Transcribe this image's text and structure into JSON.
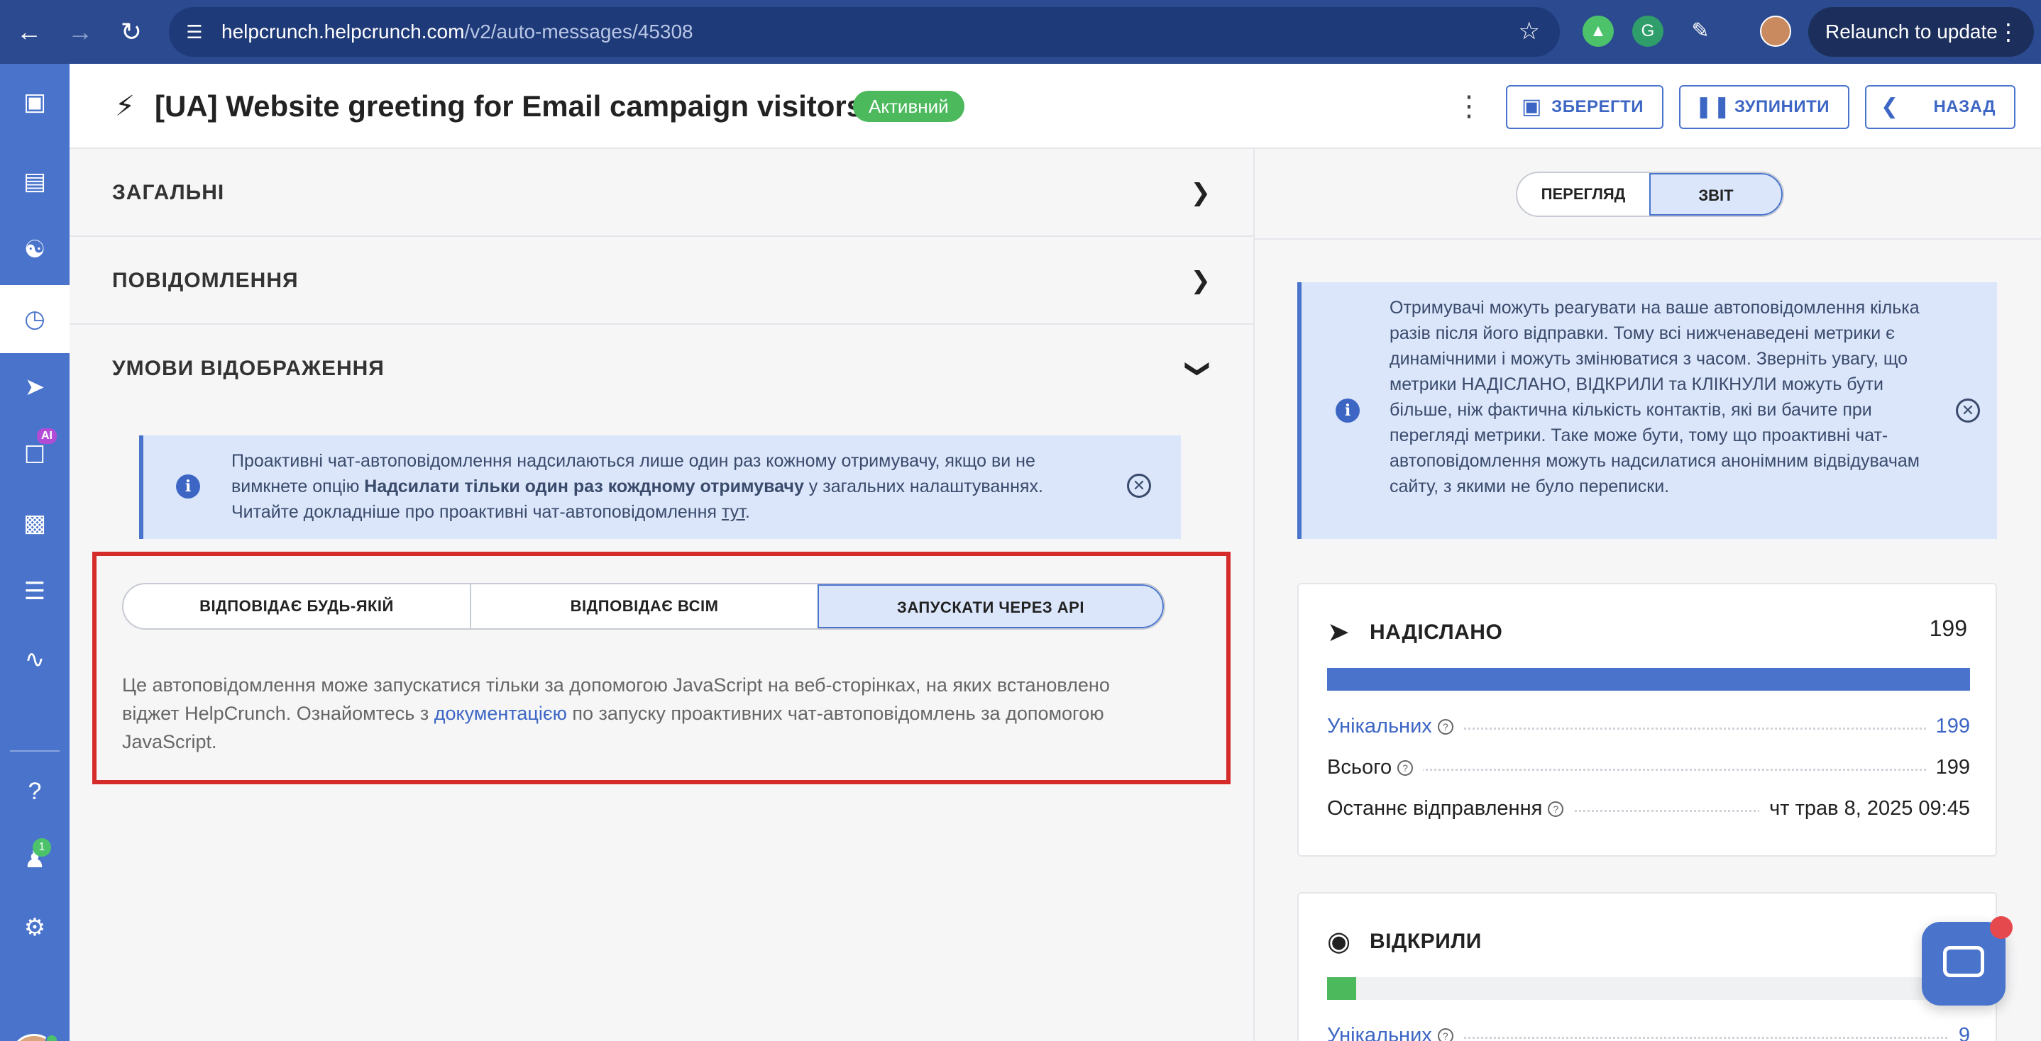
{
  "browser": {
    "url_host": "helpcrunch.helpcrunch.com",
    "url_path": "/v2/auto-messages/45308",
    "relaunch_label": "Relaunch to update"
  },
  "sidebar": {
    "items": [
      "chat-icon",
      "inbox-icon",
      "contacts-icon",
      "auto-messages-icon",
      "campaigns-icon",
      "ai-bot-icon",
      "tickets-icon",
      "knowledge-base-icon",
      "reports-icon",
      "help-icon",
      "team-icon",
      "settings-icon"
    ],
    "ai_badge": "AI",
    "team_count": "1"
  },
  "header": {
    "title": "[UA] Website greeting for Email campaign visitors",
    "status": "Активний",
    "save_label": "ЗБЕРЕГТИ",
    "stop_label": "ЗУПИНИТИ",
    "back_label": "НАЗАД"
  },
  "sections": {
    "general": "ЗАГАЛЬНІ",
    "message": "ПОВІДОМЛЕННЯ",
    "display_conditions": "УМОВИ ВІДОБРАЖЕННЯ"
  },
  "info_left": {
    "part1": "Проактивні чат-автоповідомлення надсилаються лише один раз кожному отримувачу, якщо ви не вимкнете опцію ",
    "bold": "Надсилати тільки один раз кождному отримувачу",
    "part2": " у загальних налаштуваннях. Читайте докладніше про проактивні чат-автоповідомлення ",
    "link": "тут",
    "part3": "."
  },
  "conditions": {
    "options": [
      "ВІДПОВІДАЄ БУДЬ-ЯКІЙ",
      "ВІДПОВІДАЄ ВСІМ",
      "ЗАПУСКАТИ ЧЕРЕЗ API"
    ],
    "selected": "ЗАПУСКАТИ ЧЕРЕЗ API",
    "api_desc_part1": "Це автоповідомлення може запускатися тільки за допомогою JavaScript на веб-сторінках, на яких встановлено віджет HelpCrunch. Ознайомтесь з ",
    "api_desc_link": "документацією",
    "api_desc_part2": " по запуску проактивних чат-автоповідомлень за допомогою JavaScript."
  },
  "right": {
    "toggle": [
      "ПЕРЕГЛЯД",
      "ЗВІТ"
    ],
    "toggle_selected": "ЗВІТ",
    "info": "Отримувачі можуть реагувати на ваше автоповідомлення кілька разів після його відправки. Тому всі нижченаведені метрики є динамічними і можуть змінюватися з часом. Зверніть увагу, що метрики НАДІСЛАНО, ВІДКРИЛИ та КЛІКНУЛИ можуть бути більше, ніж фактична кількість контактів, які ви бачите при перегляді метрики. Таке може бути, тому що проактивні чат-автоповідомлення можуть надсилатися анонімним відвідувачам сайту, з якими не було переписки.",
    "sent": {
      "title": "НАДІСЛАНО",
      "total": "199",
      "bar_fraction": 1.0,
      "bar_color": "#4a74cc",
      "rows": [
        {
          "label": "Унікальних",
          "value": "199"
        },
        {
          "label": "Всього",
          "value": "199"
        },
        {
          "label": "Останнє відправлення",
          "value": "чт трав 8, 2025 09:45"
        }
      ]
    },
    "opened": {
      "title": "ВІДКРИЛИ",
      "total": "4.",
      "bar_fraction": 0.045,
      "bar_color": "#4cb95c",
      "rows": [
        {
          "label": "Унікальних",
          "value": "9"
        }
      ]
    }
  }
}
